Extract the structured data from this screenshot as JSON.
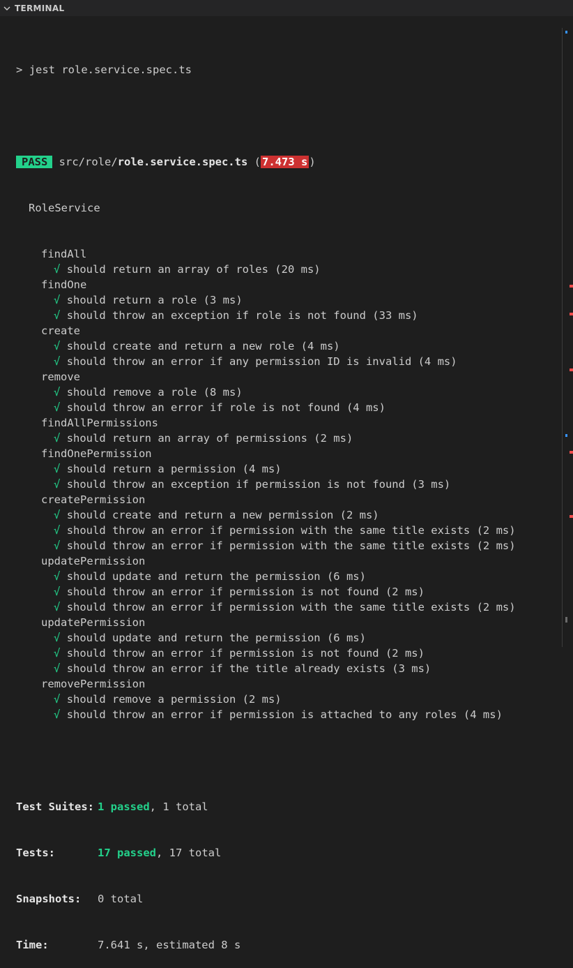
{
  "panel": {
    "title": "TERMINAL"
  },
  "command": {
    "prompt": ">",
    "text": "jest role.service.spec.ts"
  },
  "result": {
    "status": "PASS",
    "path_dir": "src/role/",
    "path_file": "role.service.spec.ts",
    "open_paren": "(",
    "duration": "7.473 s",
    "close_paren": ")"
  },
  "suite": "RoleService",
  "check_glyph": "√",
  "groups": [
    {
      "name": "findAll",
      "tests": [
        "should return an array of roles (20 ms)"
      ]
    },
    {
      "name": "findOne",
      "tests": [
        "should return a role (3 ms)",
        "should throw an exception if role is not found (33 ms)"
      ]
    },
    {
      "name": "create",
      "tests": [
        "should create and return a new role (4 ms)",
        "should throw an error if any permission ID is invalid (4 ms)"
      ]
    },
    {
      "name": "remove",
      "tests": [
        "should remove a role (8 ms)",
        "should throw an error if role is not found (4 ms)"
      ]
    },
    {
      "name": "findAllPermissions",
      "tests": [
        "should return an array of permissions (2 ms)"
      ]
    },
    {
      "name": "findOnePermission",
      "tests": [
        "should return a permission (4 ms)",
        "should throw an exception if permission is not found (3 ms)"
      ]
    },
    {
      "name": "createPermission",
      "tests": [
        "should create and return a new permission (2 ms)",
        "should throw an error if permission with the same title exists (2 ms)",
        "should throw an error if permission with the same title exists (2 ms)"
      ]
    },
    {
      "name": "updatePermission",
      "tests": [
        "should update and return the permission (6 ms)",
        "should throw an error if permission is not found (2 ms)",
        "should throw an error if permission with the same title exists (2 ms)"
      ]
    },
    {
      "name": "updatePermission",
      "tests": [
        "should update and return the permission (6 ms)",
        "should throw an error if permission is not found (2 ms)",
        "should throw an error if the title already exists (3 ms)"
      ]
    },
    {
      "name": "removePermission",
      "tests": [
        "should remove a permission (2 ms)",
        "should throw an error if permission is attached to any roles (4 ms)"
      ]
    }
  ],
  "summary": {
    "suites_label": "Test Suites:",
    "suites_passed": "1 passed",
    "suites_rest": ", 1 total",
    "tests_label": "Tests:",
    "tests_passed": "17 passed",
    "tests_rest": ", 17 total",
    "snapshots_label": "Snapshots:",
    "snapshots_value": "0 total",
    "time_label": "Time:",
    "time_value": "7.641 s, estimated 8 s"
  },
  "colors": {
    "background": "#1e1e1e",
    "pass_green": "#23d18b",
    "fail_red": "#cd3131",
    "text": "#cccccc"
  },
  "icons": {
    "panel_toggle": "chevron-down-icon",
    "check": "check-icon"
  }
}
